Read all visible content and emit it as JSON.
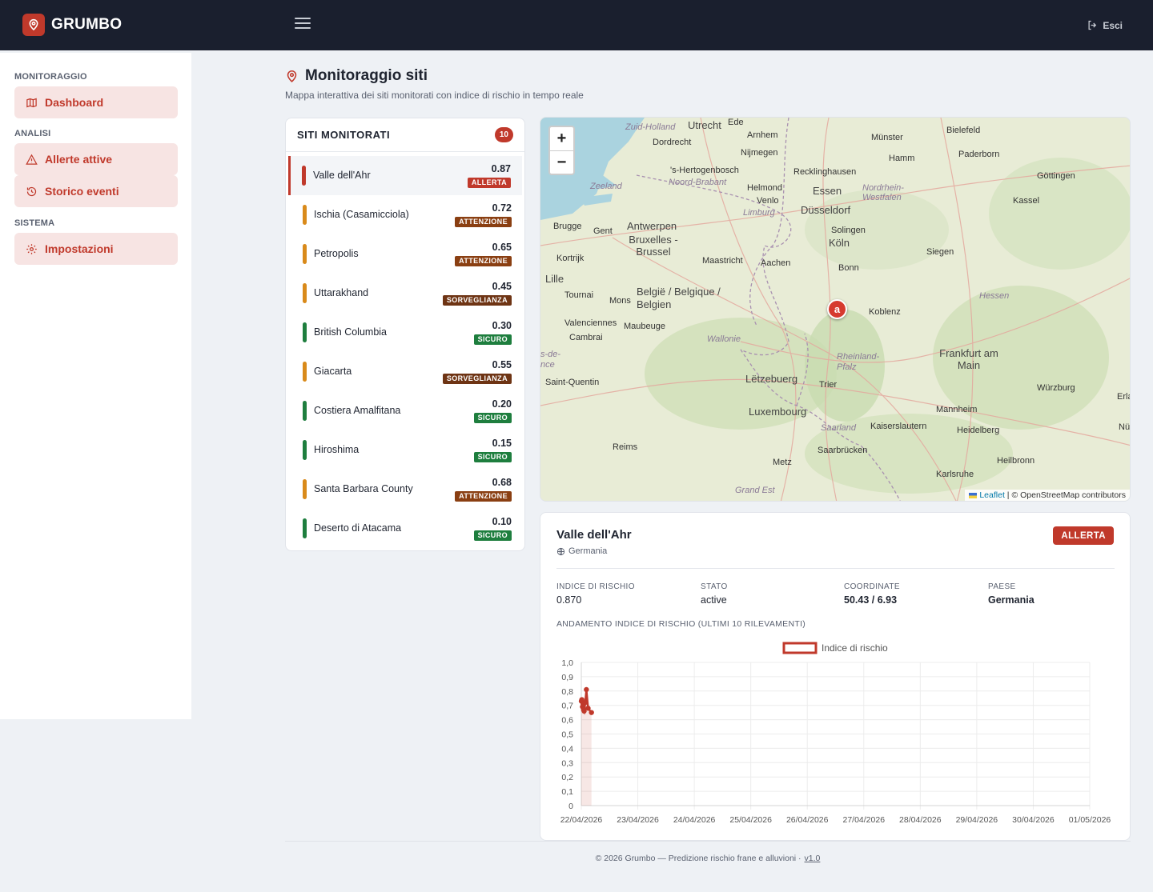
{
  "app": {
    "name": "GRUMBO",
    "logout_label": "Esci"
  },
  "sidebar": {
    "sections": [
      {
        "title": "MONITORAGGIO",
        "items": [
          {
            "label": "Dashboard",
            "icon": "map-icon"
          }
        ]
      },
      {
        "title": "ANALISI",
        "items": [
          {
            "label": "Allerte attive",
            "icon": "warning-icon"
          },
          {
            "label": "Storico eventi",
            "icon": "history-icon"
          }
        ]
      },
      {
        "title": "SISTEMA",
        "items": [
          {
            "label": "Impostazioni",
            "icon": "gear-icon"
          }
        ]
      }
    ]
  },
  "page": {
    "title": "Monitoraggio siti",
    "subtitle": "Mappa interattiva dei siti monitorati con indice di rischio in tempo reale"
  },
  "sites": {
    "title": "SITI MONITORATI",
    "count": "10",
    "items": [
      {
        "name": "Valle dell'Ahr",
        "score": "0.87",
        "status": "ALLERTA",
        "bar_color": "#c0392b",
        "badge_color": "#c0392b"
      },
      {
        "name": "Ischia (Casamicciola)",
        "score": "0.72",
        "status": "ATTENZIONE",
        "bar_color": "#d98a1a",
        "badge_color": "#8a3f12"
      },
      {
        "name": "Petropolis",
        "score": "0.65",
        "status": "ATTENZIONE",
        "bar_color": "#d98a1a",
        "badge_color": "#8a3f12"
      },
      {
        "name": "Uttarakhand",
        "score": "0.45",
        "status": "SORVEGLIANZA",
        "bar_color": "#d98a1a",
        "badge_color": "#6e3414"
      },
      {
        "name": "British Columbia",
        "score": "0.30",
        "status": "SICURO",
        "bar_color": "#1e7e3e",
        "badge_color": "#1e7e3e"
      },
      {
        "name": "Giacarta",
        "score": "0.55",
        "status": "SORVEGLIANZA",
        "bar_color": "#d98a1a",
        "badge_color": "#6e3414"
      },
      {
        "name": "Costiera Amalfitana",
        "score": "0.20",
        "status": "SICURO",
        "bar_color": "#1e7e3e",
        "badge_color": "#1e7e3e"
      },
      {
        "name": "Hiroshima",
        "score": "0.15",
        "status": "SICURO",
        "bar_color": "#1e7e3e",
        "badge_color": "#1e7e3e"
      },
      {
        "name": "Santa Barbara County",
        "score": "0.68",
        "status": "ATTENZIONE",
        "bar_color": "#d98a1a",
        "badge_color": "#8a3f12"
      },
      {
        "name": "Deserto di Atacama",
        "score": "0.10",
        "status": "SICURO",
        "bar_color": "#1e7e3e",
        "badge_color": "#1e7e3e"
      }
    ]
  },
  "map": {
    "zoom_in": "+",
    "zoom_out": "−",
    "marker_label": "a",
    "attribution_leaflet": "Leaflet",
    "attribution_osm": "| © OpenStreetMap contributors",
    "labels": {
      "zuid_holland": "Zuid-Holland",
      "utrecht": "Utrecht",
      "ede": "Ede",
      "arnhem": "Arnhem",
      "munster": "Münster",
      "bielefeld": "Bielefeld",
      "dordrecht": "Dordrecht",
      "nijmegen": "Nijmegen",
      "hamm": "Hamm",
      "paderborn": "Paderborn",
      "shertogenbosch": "'s-Hertogenbosch",
      "recklinghausen": "Recklinghausen",
      "gottingen": "Göttingen",
      "zeeland": "Zeeland",
      "noord_brabant": "Noord-Brabant",
      "helmond": "Helmond",
      "essen": "Essen",
      "nrw": "Nordrhein-Westfalen",
      "venlo": "Venlo",
      "kassel": "Kassel",
      "limburg": "Limburg",
      "dusseldorf": "Düsseldorf",
      "antwerpen": "Antwerpen",
      "brugge": "Brugge",
      "gent": "Gent",
      "solingen": "Solingen",
      "bruxelles": "Bruxelles - Brussel",
      "koln": "Köln",
      "kortrijk": "Kortrijk",
      "maastricht": "Maastricht",
      "aachen": "Aachen",
      "siegen": "Siegen",
      "bonn": "Bonn",
      "lille": "Lille",
      "belgie": "België / Belgique / Belgien",
      "tournai": "Tournai",
      "mons": "Mons",
      "hessen": "Hessen",
      "koblenz": "Koblenz",
      "valenciennes": "Valenciennes",
      "maubeuge": "Maubeuge",
      "cambrai": "Cambrai",
      "wallonie": "Wallonie",
      "frankfurt": "Frankfurt am Main",
      "rheinland": "Rheinland-Pfalz",
      "nce": "s-de-nce",
      "saint_quentin": "Saint-Quentin",
      "letzebuerg": "Lëtzebuerg",
      "trier": "Trier",
      "wurzburg": "Würzburg",
      "erla": "Erla",
      "luxembourg": "Luxembourg",
      "mannheim": "Mannheim",
      "saarland": "Saarland",
      "kaiserslautern": "Kaiserslautern",
      "heidelberg": "Heidelberg",
      "nur": "Nür",
      "reims": "Reims",
      "saarbrucken": "Saarbrücken",
      "heilbronn": "Heilbronn",
      "metz": "Metz",
      "karlsruhe": "Karlsruhe",
      "grand_est": "Grand Est"
    }
  },
  "detail": {
    "title": "Valle dell'Ahr",
    "country": "Germania",
    "status_badge": "ALLERTA",
    "stats": [
      {
        "label": "INDICE DI RISCHIO",
        "value": "0.870"
      },
      {
        "label": "STATO",
        "value": "active"
      },
      {
        "label": "COORDINATE",
        "value": "50.43 / 6.93"
      },
      {
        "label": "PAESE",
        "value": "Germania"
      }
    ],
    "trend_title": "ANDAMENTO INDICE DI RISCHIO (ULTIMI 10 RILEVAMENTI)"
  },
  "chart_data": {
    "type": "line",
    "legend": "Indice di rischio",
    "legend_position": "top",
    "x_ticks": [
      "22/04/2026",
      "23/04/2026",
      "24/04/2026",
      "25/04/2026",
      "26/04/2026",
      "27/04/2026",
      "28/04/2026",
      "29/04/2026",
      "30/04/2026",
      "01/05/2026"
    ],
    "y_ticks": [
      "0",
      "0,1",
      "0,2",
      "0,3",
      "0,4",
      "0,5",
      "0,6",
      "0,7",
      "0,8",
      "0,9",
      "1,0"
    ],
    "ylim": [
      0,
      1
    ],
    "xlim_days": [
      0,
      9
    ],
    "series": [
      {
        "name": "Indice di rischio",
        "color": "#c0392b",
        "x_days": [
          0,
          0.01,
          0.02,
          0.03,
          0.04,
          0.05,
          0.07,
          0.09,
          0.12,
          0.18
        ],
        "y": [
          0.73,
          0.74,
          0.69,
          0.71,
          0.67,
          0.66,
          0.72,
          0.81,
          0.68,
          0.65
        ]
      }
    ],
    "grid": true
  },
  "footer": {
    "text": "© 2026 Grumbo — Predizione rischio frane e alluvioni  ·",
    "version": "v1.0"
  }
}
